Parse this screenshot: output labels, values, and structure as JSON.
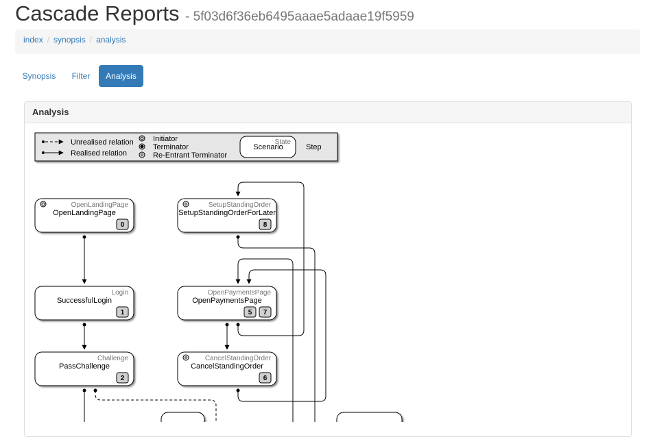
{
  "header": {
    "title": "Cascade Reports",
    "subtitle": "- 5f03d6f36eb6495aaae5adaae19f5959"
  },
  "breadcrumb": [
    "index",
    "synopsis",
    "analysis"
  ],
  "tabs": [
    {
      "label": "Synopsis",
      "active": false
    },
    {
      "label": "Filter",
      "active": false
    },
    {
      "label": "Analysis",
      "active": true
    }
  ],
  "panel": {
    "title": "Analysis"
  },
  "legend": {
    "unrealised": "Unrealised relation",
    "realised": "Realised relation",
    "initiator": "Initiator",
    "terminator": "Terminator",
    "reentrant": "Re-Entrant Terminator",
    "state": "State",
    "scenario": "Scenario",
    "step": "Step"
  },
  "nodes": {
    "open_landing": {
      "state": "OpenLandingPage",
      "scenario": "OpenLandingPage",
      "steps": [
        "0"
      ]
    },
    "login": {
      "state": "Login",
      "scenario": "SuccessfulLogin",
      "steps": [
        "1"
      ]
    },
    "challenge": {
      "state": "Challenge",
      "scenario": "PassChallenge",
      "steps": [
        "2"
      ]
    },
    "setup_standing": {
      "state": "SetupStandingOrder",
      "scenario": "SetupStandingOrderForLater",
      "steps": [
        "8"
      ]
    },
    "open_payments": {
      "state": "OpenPaymentsPage",
      "scenario": "OpenPaymentsPage",
      "steps": [
        "5",
        "7"
      ]
    },
    "cancel_standing": {
      "state": "CancelStandingOrder",
      "scenario": "CancelStandingOrder",
      "steps": [
        "6"
      ]
    }
  },
  "colors": {
    "link": "#337ab7",
    "active_tab": "#337ab7",
    "muted": "#777777"
  }
}
